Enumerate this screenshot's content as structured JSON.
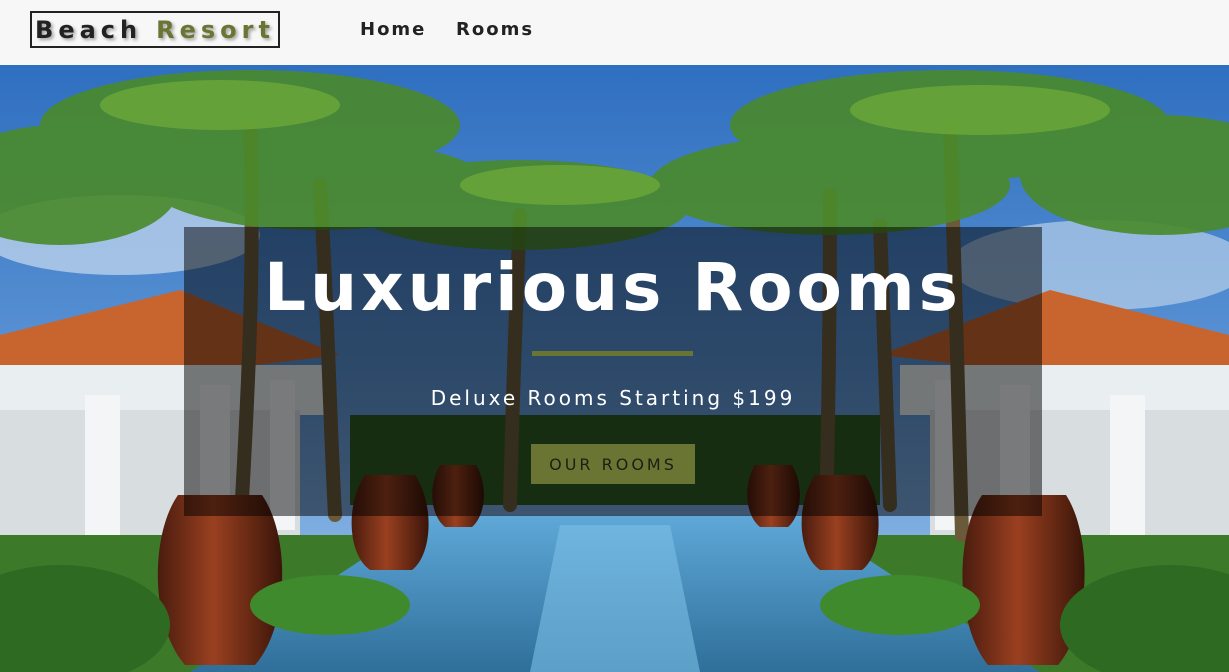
{
  "navbar": {
    "logo_word1": "Beach",
    "logo_word2": "Resort",
    "links": [
      {
        "label": "Home"
      },
      {
        "label": "Rooms"
      }
    ]
  },
  "hero": {
    "image": "resort-pool-palm-trees",
    "title": "Luxurious Rooms",
    "subtitle": "Deluxe Rooms Starting $199",
    "button_label": "OUR ROOMS"
  },
  "colors": {
    "accent": "#6b7533",
    "navbar_bg": "#f7f7f7",
    "text_dark": "#222222",
    "banner_overlay": "rgba(0,0,0,0.5)"
  }
}
